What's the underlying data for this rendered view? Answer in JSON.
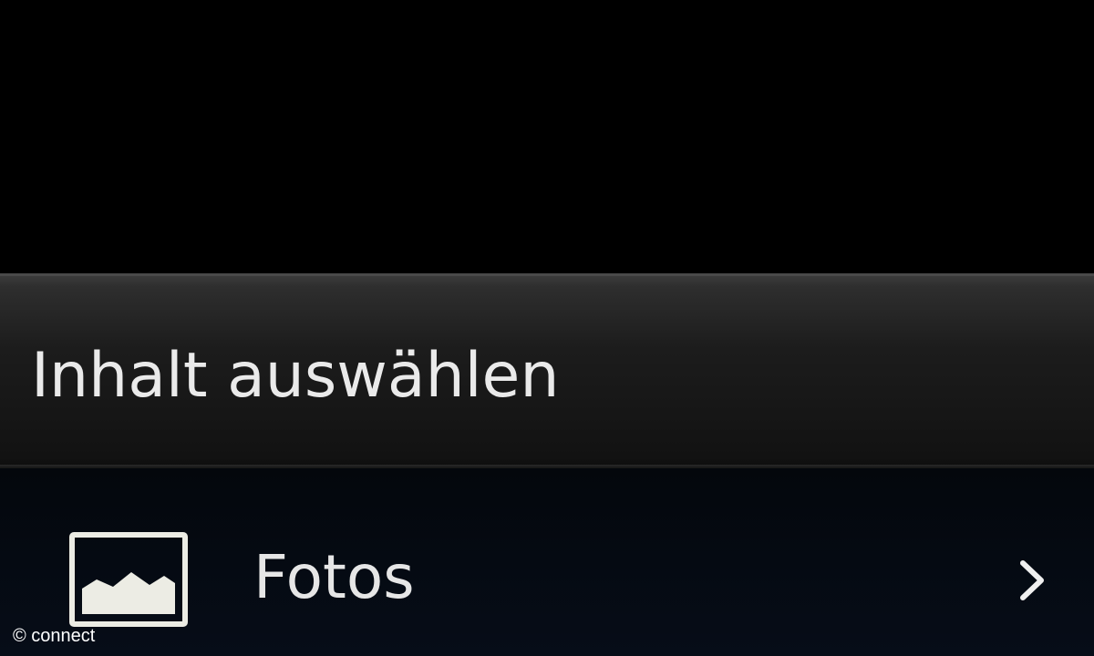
{
  "dialog": {
    "title": "Inhalt auswählen"
  },
  "list": {
    "items": [
      {
        "label": "Fotos",
        "icon": "photo-icon",
        "trailing_icon": "chevron-right-icon"
      }
    ]
  },
  "watermark": {
    "text": "© connect"
  },
  "colors": {
    "background": "#000000",
    "text": "#eaeaea",
    "header_top": "#3b3b3b",
    "header_bottom": "#0d0d0d"
  }
}
